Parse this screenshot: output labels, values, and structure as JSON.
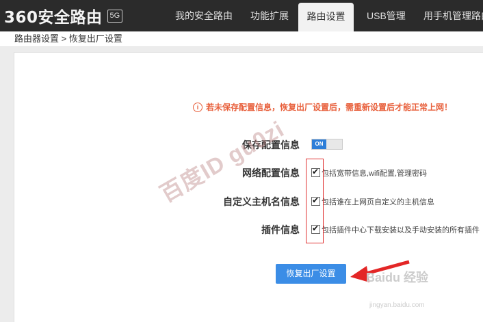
{
  "header": {
    "logo_text": "360安全路由",
    "logo_badge": "5G",
    "nav": [
      {
        "label": "我的安全路由"
      },
      {
        "label": "功能扩展"
      },
      {
        "label": "路由设置"
      },
      {
        "label": "USB管理"
      },
      {
        "label": "用手机管理路由"
      }
    ]
  },
  "breadcrumb": "路由器设置 > 恢复出厂设置",
  "warning": "若未保存配置信息，恢复出厂设置后，需重新设置后才能正常上网！",
  "rows": [
    {
      "label": "保存配置信息",
      "toggle": "ON"
    },
    {
      "label": "网络配置信息",
      "desc": "包括宽带信息,wifi配置,管理密码"
    },
    {
      "label": "自定义主机名信息",
      "desc": "包括谁在上网页自定义的主机信息"
    },
    {
      "label": "插件信息",
      "desc": "包括插件中心下载安装以及手动安装的所有插件"
    }
  ],
  "reset_button": "恢复出厂设置",
  "watermark": "百度ID gu0zi",
  "baidu_logo": "Baidu 经验",
  "baidu_url": "jingyan.baidu.com"
}
